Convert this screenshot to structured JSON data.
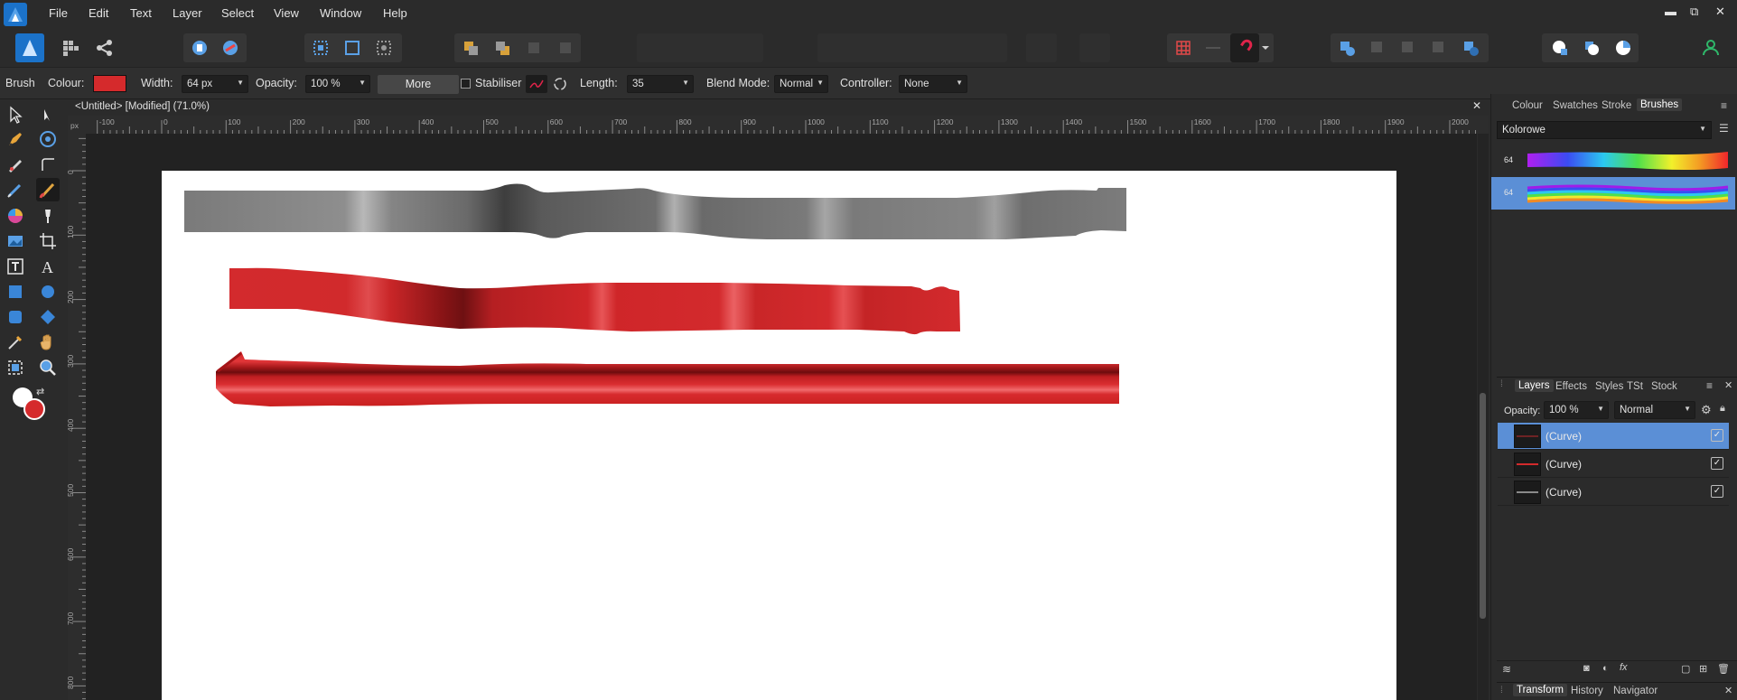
{
  "menubar": {
    "items": [
      "File",
      "Edit",
      "Text",
      "Layer",
      "Select",
      "View",
      "Window",
      "Help"
    ],
    "window_controls": {
      "minimize": "▬",
      "restore": "⧉",
      "close": "✕"
    }
  },
  "context": {
    "tool_name": "Brush",
    "colour_label": "Colour:",
    "colour_value": "#d52a2c",
    "width_label": "Width:",
    "width_value": "64 px",
    "opacity_label": "Opacity:",
    "opacity_value": "100 %",
    "more_label": "More",
    "stabiliser_label": "Stabiliser",
    "length_label": "Length:",
    "length_value": "35",
    "blend_label": "Blend Mode:",
    "blend_value": "Normal",
    "controller_label": "Controller:",
    "controller_value": "None"
  },
  "document": {
    "title": "<Untitled> [Modified] (71.0%)",
    "close_glyph": "✕",
    "ruler_unit": "px",
    "ruler_top_ticks": [
      "-100",
      "0",
      "100",
      "200",
      "300",
      "400",
      "500",
      "600",
      "700",
      "800",
      "900",
      "1000",
      "1100",
      "1200",
      "1300",
      "1400",
      "1500",
      "1600",
      "1700",
      "1800",
      "1900",
      "2000"
    ],
    "ruler_left_ticks": [
      "0",
      "100",
      "200",
      "300",
      "400",
      "500",
      "600",
      "700",
      "800"
    ]
  },
  "brushes_panel": {
    "tabs": [
      "Colour",
      "Swatches",
      "Stroke",
      "Brushes"
    ],
    "active_tab": "Brushes",
    "category": "Kolorowe",
    "brushes": [
      {
        "size": "64",
        "selected": false
      },
      {
        "size": "64",
        "selected": true
      }
    ]
  },
  "layers_panel": {
    "tabs": [
      "Layers",
      "Effects",
      "Styles",
      "TSt",
      "Stock"
    ],
    "active_tab": "Layers",
    "opacity_label": "Opacity:",
    "opacity_value": "100 %",
    "blend_value": "Normal",
    "layers": [
      {
        "name": "(Curve)",
        "selected": true,
        "visible": true
      },
      {
        "name": "(Curve)",
        "selected": false,
        "visible": true
      },
      {
        "name": "(Curve)",
        "selected": false,
        "visible": true
      }
    ]
  },
  "bottom_tabs": [
    "Transform",
    "History",
    "Navigator"
  ],
  "colors": {
    "accent": "#5b8fd6",
    "primary_colour": "#d52a2c",
    "secondary_colour": "#ffffff"
  }
}
